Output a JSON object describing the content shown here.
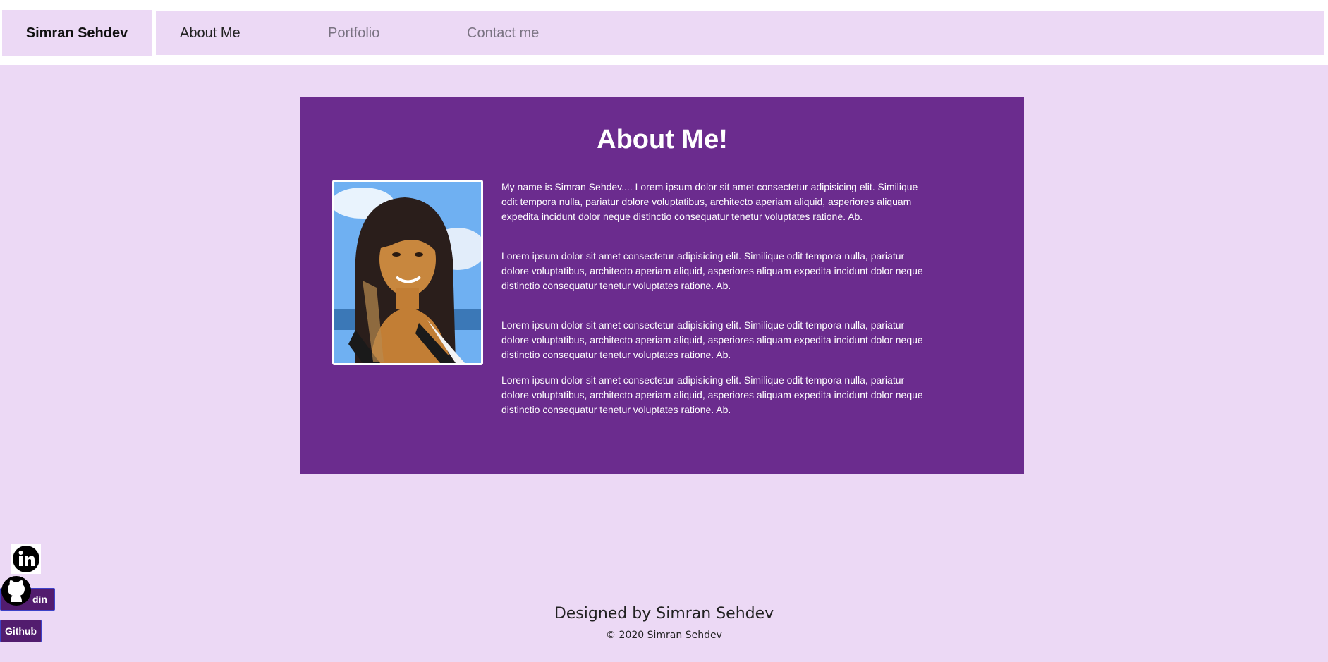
{
  "nav": {
    "brand": "Simran Sehdev",
    "links": [
      "About Me",
      "Portfolio",
      "Contact me"
    ]
  },
  "about": {
    "title": "About Me!",
    "paragraphs": [
      "My name is Simran Sehdev.... Lorem ipsum dolor sit amet consectetur adipisicing elit. Similique odit tempora nulla, pariatur dolore voluptatibus, architecto aperiam aliquid, asperiores aliquam expedita incidunt dolor neque distinctio consequatur tenetur voluptates ratione. Ab.",
      "Lorem ipsum dolor sit amet consectetur adipisicing elit. Similique odit tempora nulla, pariatur dolore voluptatibus, architecto aperiam aliquid, asperiores aliquam expedita incidunt dolor neque distinctio consequatur tenetur voluptates ratione. Ab.",
      "Lorem ipsum dolor sit amet consectetur adipisicing elit. Similique odit tempora nulla, pariatur dolore voluptatibus, architecto aperiam aliquid, asperiores aliquam expedita incidunt dolor neque distinctio consequatur tenetur voluptates ratione. Ab.",
      "Lorem ipsum dolor sit amet consectetur adipisicing elit. Similique odit tempora nulla, pariatur dolore voluptatibus, architecto aperiam aliquid, asperiores aliquam expedita incidunt dolor neque distinctio consequatur tenetur voluptates ratione. Ab."
    ]
  },
  "social": {
    "linkedin_label": "din",
    "github_label": "Github",
    "icons": [
      "linkedin-icon",
      "github-icon"
    ]
  },
  "footer": {
    "designed_by": "Designed by Simran Sehdev",
    "copyright": "© 2020 Simran Sehdev"
  },
  "colors": {
    "page_bg": "#ecd9f5",
    "card_bg": "#6b2c8e",
    "button_bg": "#521c6e",
    "button_border": "#3d42c8"
  }
}
